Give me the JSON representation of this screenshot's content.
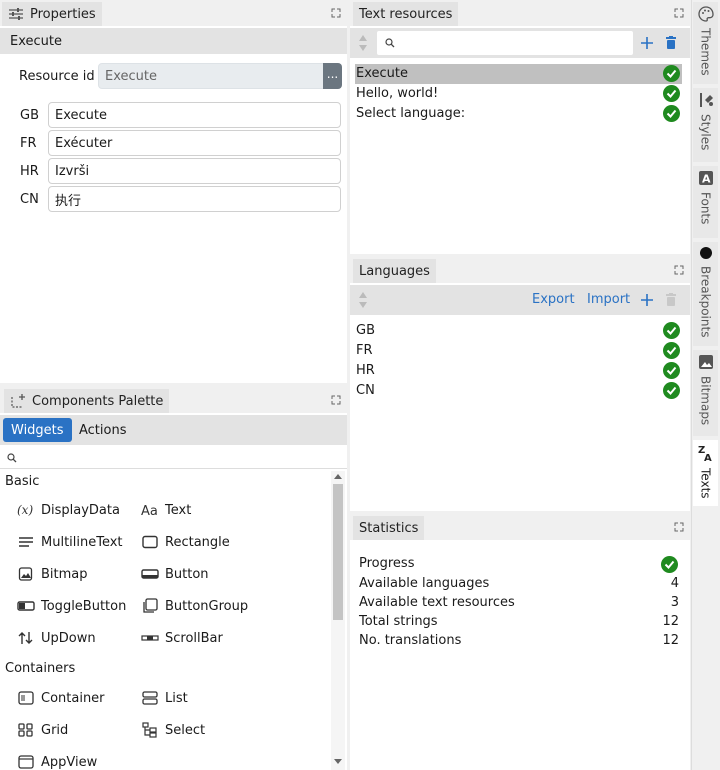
{
  "properties": {
    "tab": "Properties",
    "section": "Execute",
    "resource_id_label": "Resource id",
    "resource_id_value": "Execute",
    "ellipsis": "...",
    "translations": [
      {
        "lang": "GB",
        "value": "Execute"
      },
      {
        "lang": "FR",
        "value": "Exécuter"
      },
      {
        "lang": "HR",
        "value": "Izvrši"
      },
      {
        "lang": "CN",
        "value": "执行"
      }
    ]
  },
  "palette": {
    "tab": "Components Palette",
    "tabs": [
      "Widgets",
      "Actions"
    ],
    "search_placeholder": "",
    "groups": [
      {
        "name": "Basic"
      },
      {
        "name": "Containers"
      }
    ],
    "basic": [
      {
        "label": "DisplayData",
        "icon": "display-data-icon"
      },
      {
        "label": "Text",
        "icon": "text-icon"
      },
      {
        "label": "MultilineText",
        "icon": "multiline-text-icon"
      },
      {
        "label": "Rectangle",
        "icon": "rectangle-icon"
      },
      {
        "label": "Bitmap",
        "icon": "bitmap-icon"
      },
      {
        "label": "Button",
        "icon": "button-icon"
      },
      {
        "label": "ToggleButton",
        "icon": "toggle-button-icon"
      },
      {
        "label": "ButtonGroup",
        "icon": "button-group-icon"
      },
      {
        "label": "UpDown",
        "icon": "up-down-icon"
      },
      {
        "label": "ScrollBar",
        "icon": "scrollbar-icon"
      }
    ],
    "containers": [
      {
        "label": "Container",
        "icon": "container-icon"
      },
      {
        "label": "List",
        "icon": "list-icon"
      },
      {
        "label": "Grid",
        "icon": "grid-icon"
      },
      {
        "label": "Select",
        "icon": "select-icon"
      },
      {
        "label": "AppView",
        "icon": "app-view-icon"
      }
    ]
  },
  "text_resources": {
    "tab": "Text resources",
    "search_placeholder": "",
    "items": [
      "Execute",
      "Hello, world!",
      "Select language:"
    ]
  },
  "languages": {
    "tab": "Languages",
    "export": "Export",
    "import": "Import",
    "items": [
      "GB",
      "FR",
      "HR",
      "CN"
    ]
  },
  "statistics": {
    "tab": "Statistics",
    "rows": [
      {
        "label": "Progress",
        "value": ""
      },
      {
        "label": "Available languages",
        "value": "4"
      },
      {
        "label": "Available text resources",
        "value": "3"
      },
      {
        "label": "Total strings",
        "value": "12"
      },
      {
        "label": "No. translations",
        "value": "12"
      }
    ]
  },
  "side_tabs": [
    {
      "label": "Themes",
      "icon": "palette-icon"
    },
    {
      "label": "Styles",
      "icon": "brush-icon"
    },
    {
      "label": "Fonts",
      "icon": "font-icon"
    },
    {
      "label": "Breakpoints",
      "icon": "circle-icon"
    },
    {
      "label": "Bitmaps",
      "icon": "image-icon"
    },
    {
      "label": "Texts",
      "icon": "translate-icon"
    }
  ],
  "colors": {
    "accent": "#2a72c4",
    "success": "#1f8a1f"
  }
}
